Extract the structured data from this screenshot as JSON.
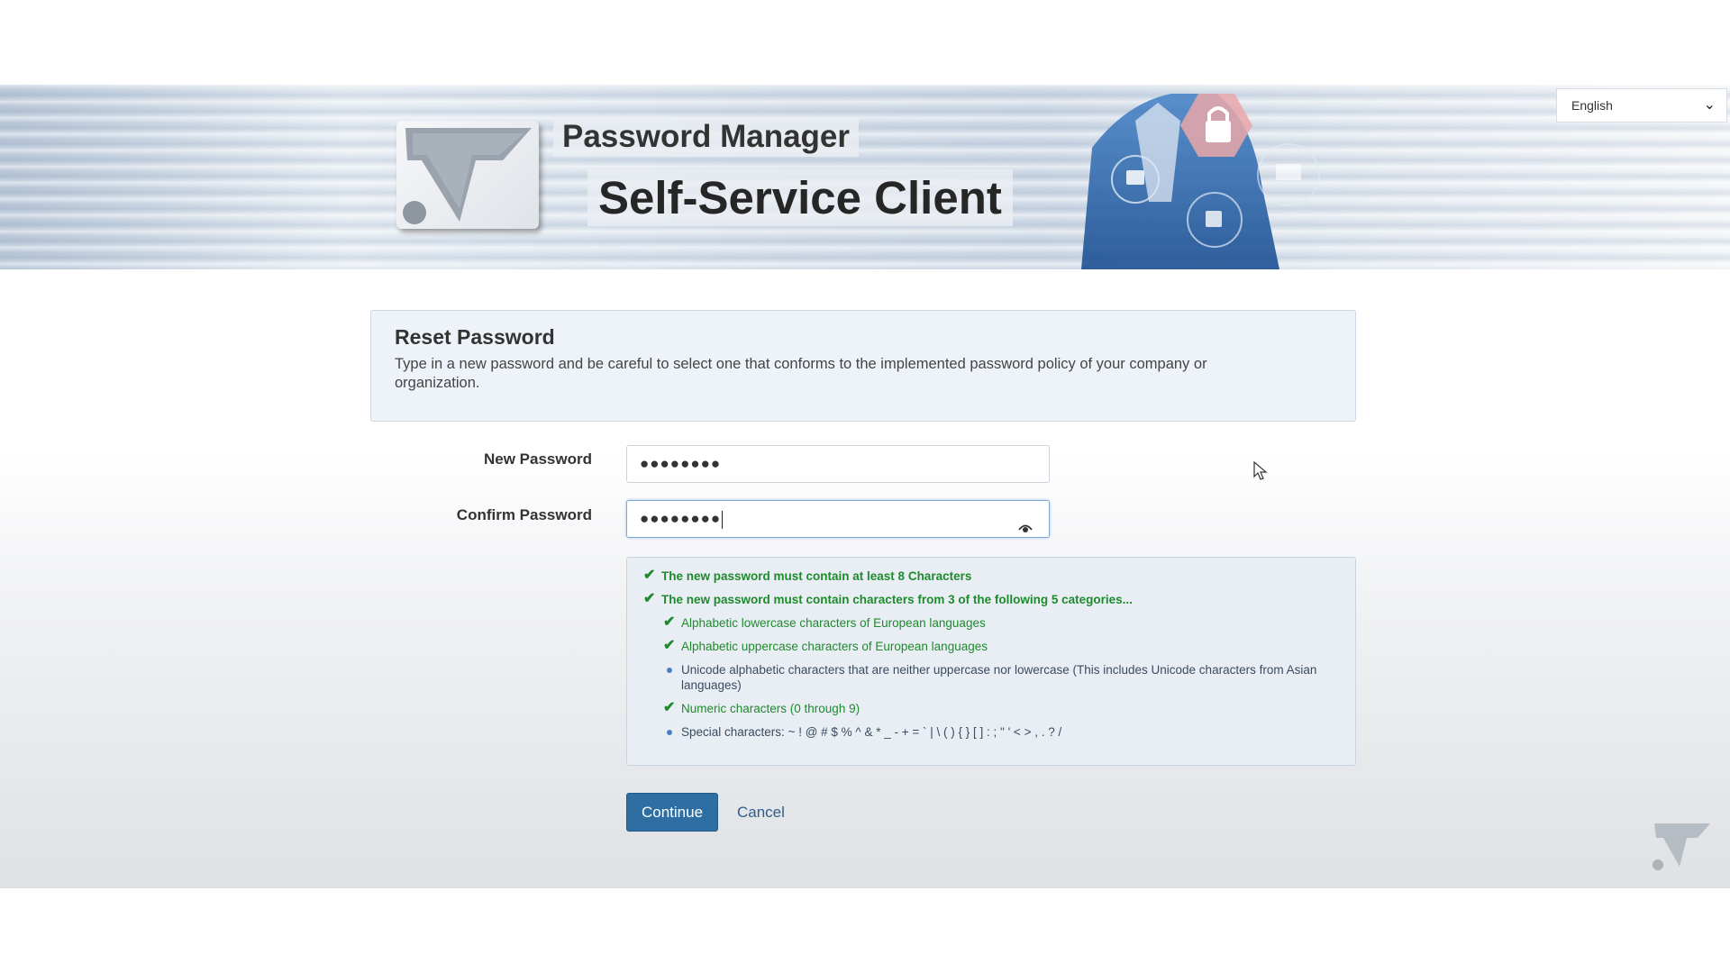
{
  "header": {
    "title": "Password Manager",
    "subtitle": "Self-Service Client",
    "language": "English"
  },
  "intro": {
    "heading": "Reset Password",
    "text": "Type in a new password and be careful to select one that conforms to the implemented password policy of your company or organization."
  },
  "form": {
    "new_password_label": "New Password",
    "new_password_value": "●●●●●●●●",
    "confirm_password_label": "Confirm Password",
    "confirm_password_value": "●●●●●●●●"
  },
  "policy": {
    "rules": [
      {
        "text": "The new password must contain at least 8 Characters",
        "satisfied": true,
        "level": 0
      },
      {
        "text": "The new password must contain characters from 3 of the following 5 categories...",
        "satisfied": true,
        "level": 0
      },
      {
        "text": "Alphabetic lowercase characters of European languages",
        "satisfied": true,
        "level": 1
      },
      {
        "text": "Alphabetic uppercase characters of European languages",
        "satisfied": true,
        "level": 1
      },
      {
        "text": "Unicode alphabetic characters that are neither uppercase nor lowercase (This includes Unicode characters from Asian languages)",
        "satisfied": false,
        "level": 1
      },
      {
        "text": "Numeric characters (0 through 9)",
        "satisfied": true,
        "level": 1
      },
      {
        "text": "Special characters: ~ ! @ # $ % ^ & * _ - + = ` | \\ ( ) { } [ ] : ; \" ' < > , . ? /",
        "satisfied": false,
        "level": 1
      }
    ]
  },
  "buttons": {
    "continue": "Continue",
    "cancel": "Cancel"
  },
  "colors": {
    "primary": "#2f6ea3",
    "success": "#1e8a2d",
    "link": "#2f5e8c"
  }
}
